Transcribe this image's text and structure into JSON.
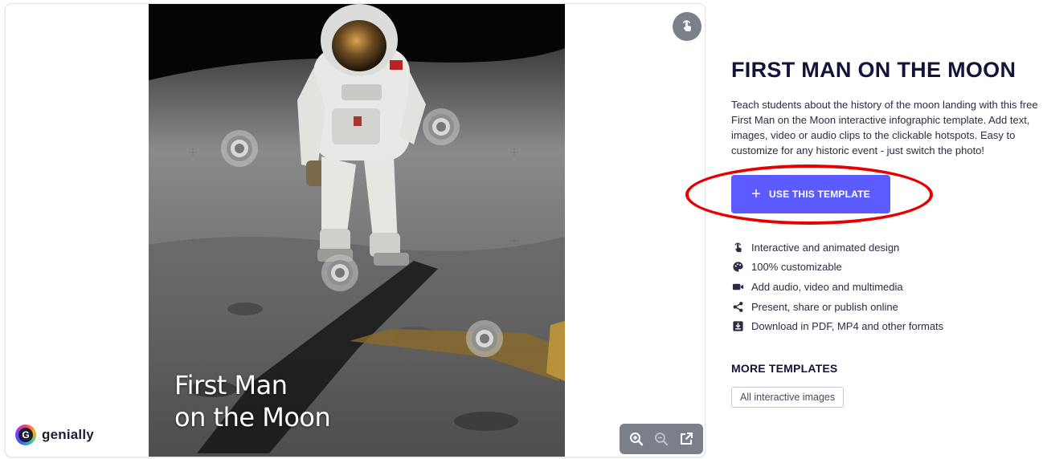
{
  "viewer": {
    "photo_title_line1": "First Man",
    "photo_title_line2": "on the Moon",
    "brand_name": "genially",
    "brand_letter": "G"
  },
  "template": {
    "title": "FIRST MAN ON THE MOON",
    "description": "Teach students about the history of the moon landing with this free First Man on the Moon interactive infographic template. Add text, images, video or audio clips to the clickable hotspots. Easy to customize for any historic event - just switch the photo!",
    "cta_icon": "+",
    "cta_label": "USE THIS TEMPLATE"
  },
  "features": [
    {
      "icon": "interactive-icon",
      "label": "Interactive and animated design"
    },
    {
      "icon": "palette-icon",
      "label": "100% customizable"
    },
    {
      "icon": "video-icon",
      "label": "Add audio, video and multimedia"
    },
    {
      "icon": "share-icon",
      "label": "Present, share or publish online"
    },
    {
      "icon": "download-icon",
      "label": "Download in PDF, MP4 and other formats"
    }
  ],
  "more": {
    "title": "MORE TEMPLATES",
    "tag": "All interactive images"
  },
  "colors": {
    "accent": "#5b5bff",
    "highlight": "#e60000",
    "heading": "#13143a"
  }
}
